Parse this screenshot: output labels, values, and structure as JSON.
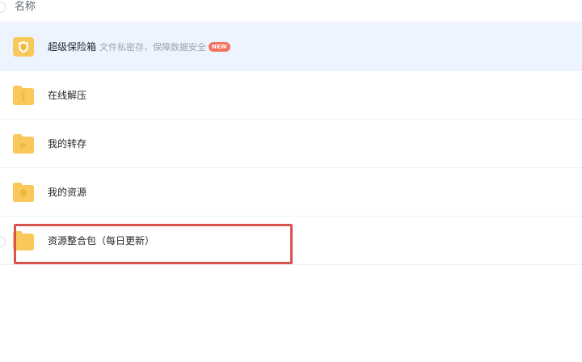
{
  "header": {
    "name_label": "名称"
  },
  "rows": [
    {
      "name": "超级保险箱",
      "subtitle": "文件私密存，保障数据安全",
      "badge": "NEW",
      "icon": "safe-folder-icon",
      "highlighted": true
    },
    {
      "name": "在线解压",
      "icon": "zip-folder-icon"
    },
    {
      "name": "我的转存",
      "icon": "transfer-folder-icon"
    },
    {
      "name": "我的资源",
      "icon": "resource-folder-icon"
    },
    {
      "name": "资源整合包（每日更新）",
      "icon": "folder-icon",
      "annotated": true
    }
  ],
  "colors": {
    "folder": "#f8c95a",
    "folder_dark": "#f0b53d",
    "highlight_bg": "#eef4ff",
    "annotation": "#d9534f",
    "badge": "#f5735e"
  }
}
